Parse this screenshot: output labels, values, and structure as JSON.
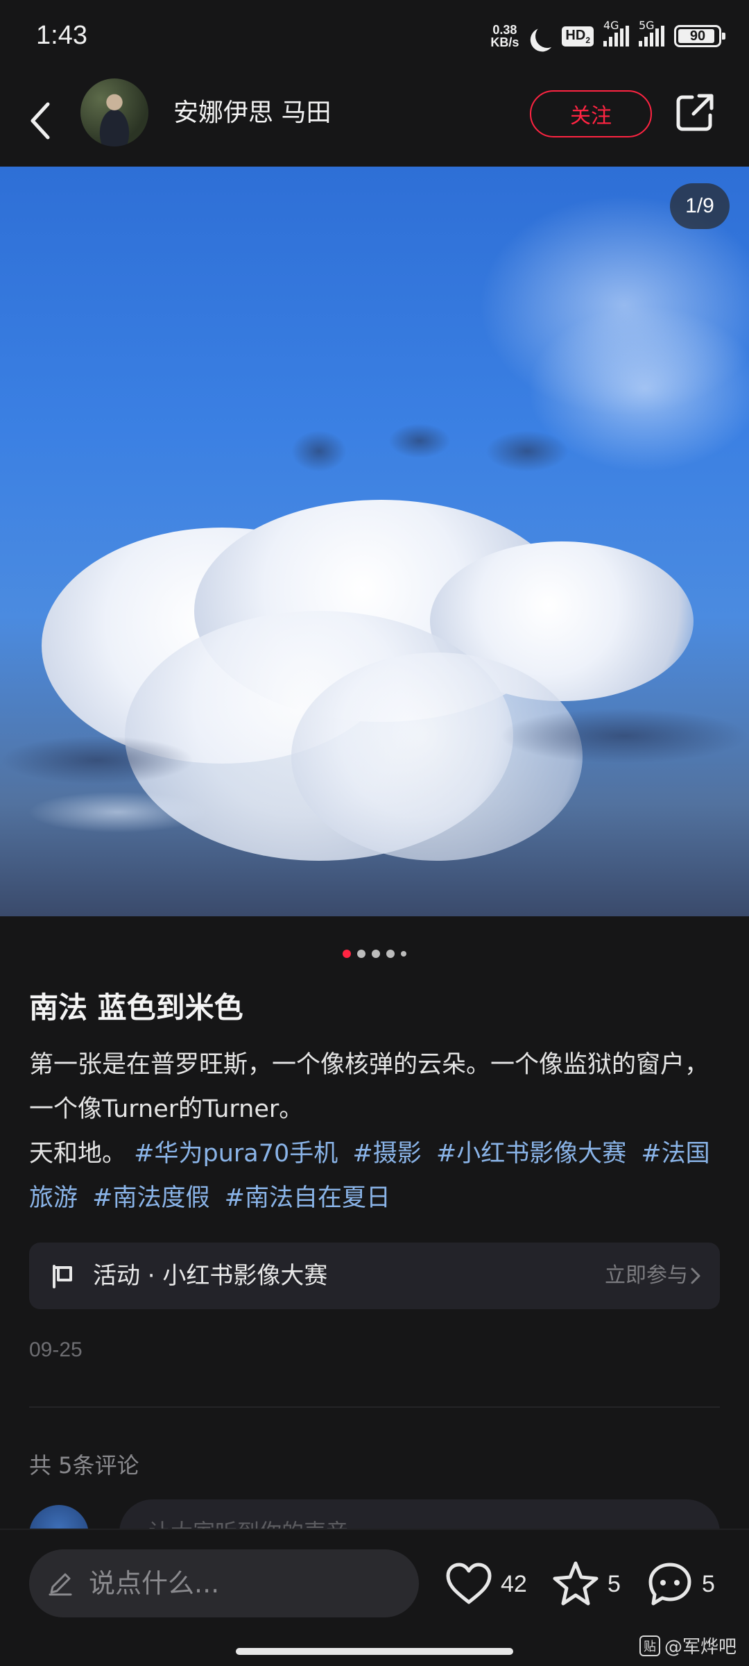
{
  "status_bar": {
    "time": "1:43",
    "net_speed_value": "0.38",
    "net_speed_unit": "KB/s",
    "hd_label": "HD",
    "hd_sub": "2",
    "network_1": "4G",
    "network_2": "5G",
    "battery": "90"
  },
  "header": {
    "author_name": "安娜伊思 马田",
    "follow_label": "关注"
  },
  "image": {
    "counter": "1/9",
    "sky_color": "#3b80e3"
  },
  "post": {
    "title": "南法 蓝色到米色",
    "body_line_1": "第一张是在普罗旺斯，一个像核弹的云朵。一个像监狱的窗户，一个像Turner的Turner。",
    "body_line_2": "天和地。",
    "tags": [
      "#华为pura70手机",
      "#摄影",
      "#小红书影像大赛",
      "#法国旅游",
      "#南法度假",
      "#南法自在夏日"
    ],
    "date": "09-25"
  },
  "activity": {
    "label": "活动 · 小红书影像大赛",
    "join_label": "立即参与"
  },
  "comments": {
    "count_label": "共 5条评论",
    "input_placeholder": "让大家听到你的声音"
  },
  "bottom_bar": {
    "input_placeholder": "说点什么...",
    "likes": "42",
    "collects": "5",
    "comments": "5",
    "accent": "#ff2442"
  },
  "watermark": {
    "logo_text": "贴",
    "text": "@军烨吧"
  }
}
